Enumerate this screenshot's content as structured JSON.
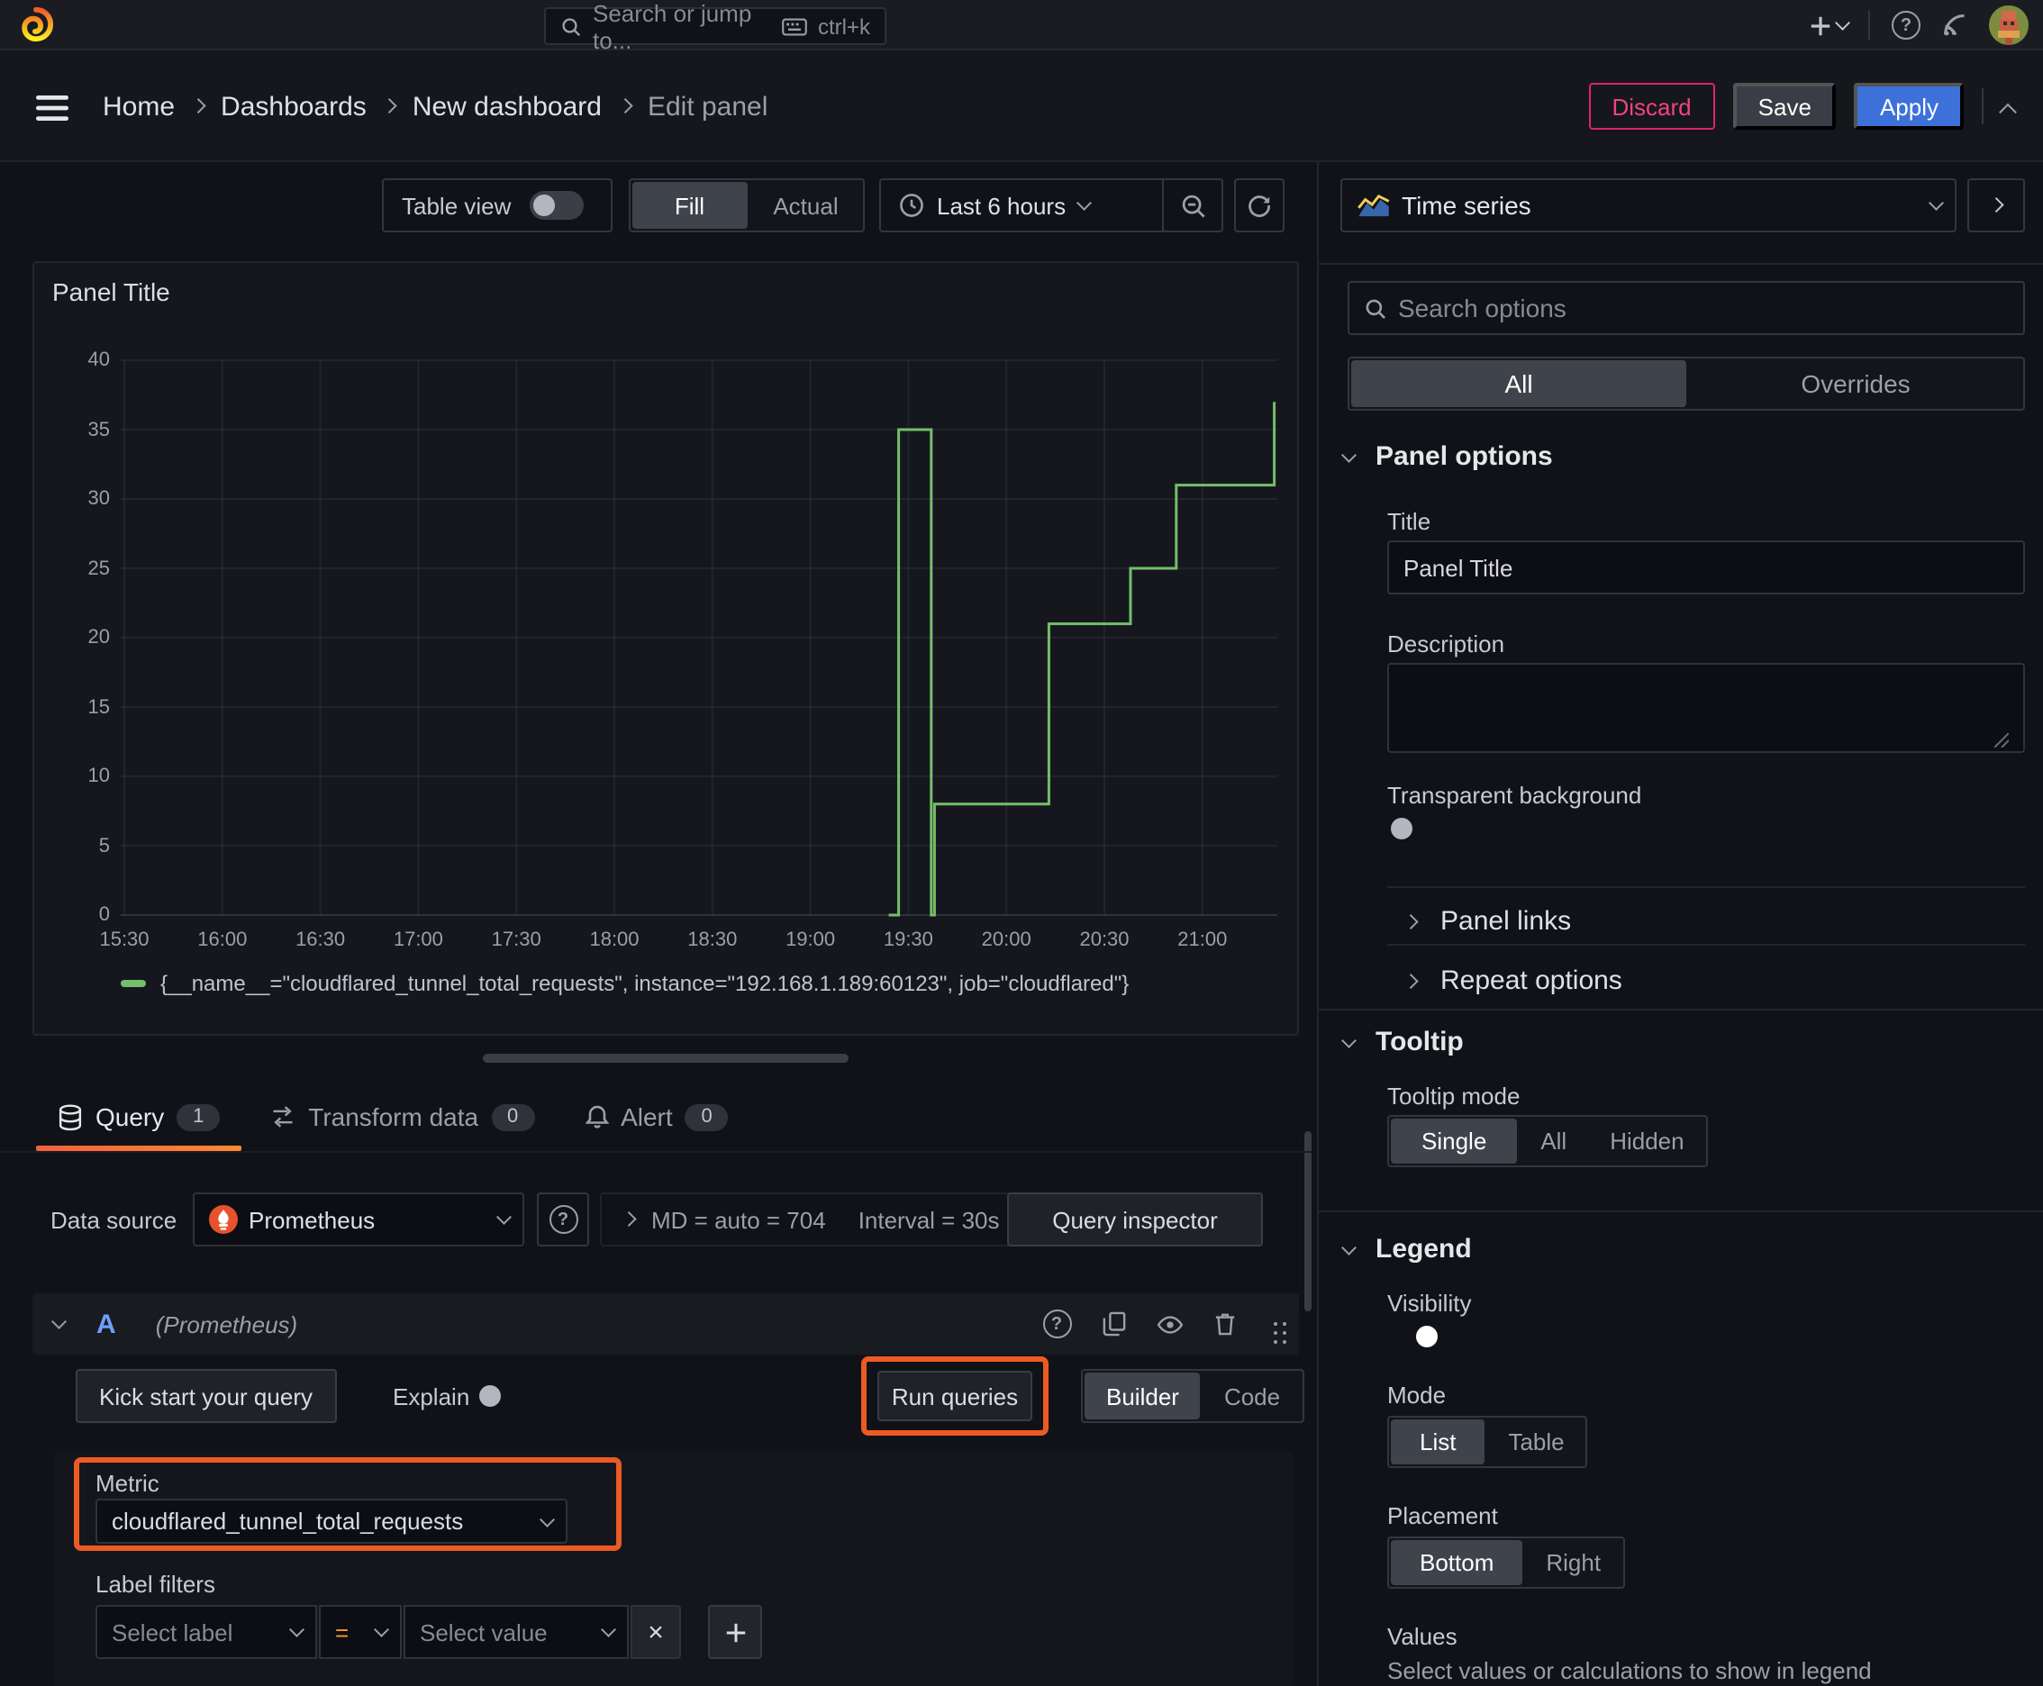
{
  "colors": {
    "green": "#73BF69",
    "annotation": "#ec5b24",
    "blue": "#3D71D9",
    "tab_gradient_start": "#F55F3E",
    "tab_gradient_end": "#FF8833"
  },
  "icons": {
    "help": "?",
    "close": "×"
  },
  "topbar": {
    "search_placeholder": "Search or jump to...",
    "shortcut": "ctrl+k"
  },
  "nav": {
    "breadcrumbs": [
      "Home",
      "Dashboards",
      "New dashboard",
      "Edit panel"
    ],
    "discard": "Discard",
    "save": "Save",
    "apply": "Apply"
  },
  "toolbar": {
    "table_view": "Table view",
    "fill": "Fill",
    "actual": "Actual",
    "time_range": "Last 6 hours"
  },
  "panel": {
    "title": "Panel Title"
  },
  "chart_data": {
    "type": "line",
    "title": "Panel Title",
    "line_interpolation": "step-after",
    "grid": true,
    "legend_position": "bottom",
    "ylim": [
      0,
      40
    ],
    "y_ticks": [
      0,
      5,
      10,
      15,
      20,
      25,
      30,
      35,
      40
    ],
    "x_ticks": [
      "15:30",
      "16:00",
      "16:30",
      "17:00",
      "17:30",
      "18:00",
      "18:30",
      "19:00",
      "19:30",
      "20:00",
      "20:30",
      "21:00"
    ],
    "series": [
      {
        "name": "{__name__=\"cloudflared_tunnel_total_requests\", instance=\"192.168.1.189:60123\", job=\"cloudflared\"}",
        "color": "#73BF69",
        "points": [
          [
            "19:24",
            0
          ],
          [
            "19:27",
            0
          ],
          [
            "19:27",
            35
          ],
          [
            "19:37",
            35
          ],
          [
            "19:37",
            0
          ],
          [
            "19:38",
            0
          ],
          [
            "19:38",
            8
          ],
          [
            "20:13",
            8
          ],
          [
            "20:13",
            21
          ],
          [
            "20:38",
            21
          ],
          [
            "20:38",
            25
          ],
          [
            "20:52",
            25
          ],
          [
            "20:52",
            31
          ],
          [
            "21:22",
            31
          ],
          [
            "21:22",
            37
          ]
        ]
      }
    ]
  },
  "tabs": [
    {
      "label": "Query",
      "count": "1"
    },
    {
      "label": "Transform data",
      "count": "0"
    },
    {
      "label": "Alert",
      "count": "0"
    }
  ],
  "query_toolbar": {
    "ds_label": "Data source",
    "ds_value": "Prometheus",
    "stats_md": "MD = auto = 704",
    "stats_interval": "Interval = 30s",
    "inspector": "Query inspector"
  },
  "query_row": {
    "ref": "A",
    "ds_hint": "(Prometheus)"
  },
  "query_actions": {
    "kickstart": "Kick start your query",
    "explain": "Explain",
    "run": "Run queries",
    "builder": "Builder",
    "code": "Code"
  },
  "metric": {
    "label": "Metric",
    "value": "cloudflared_tunnel_total_requests"
  },
  "filters": {
    "label": "Label filters",
    "select_label": "Select label",
    "operator": "=",
    "select_value": "Select value"
  },
  "options": {
    "viz": "Time series",
    "search_placeholder": "Search options",
    "tabs": [
      "All",
      "Overrides"
    ],
    "panel_options": {
      "header": "Panel options",
      "title_label": "Title",
      "title_value": "Panel Title",
      "description_label": "Description",
      "transparent_label": "Transparent background"
    },
    "panel_links": "Panel links",
    "repeat_options": "Repeat options",
    "tooltip": {
      "header": "Tooltip",
      "mode_label": "Tooltip mode",
      "modes": [
        "Single",
        "All",
        "Hidden"
      ],
      "selected": "Single"
    },
    "legend": {
      "header": "Legend",
      "visibility_label": "Visibility",
      "mode_label": "Mode",
      "modes": [
        "List",
        "Table"
      ],
      "selected_mode": "List",
      "placement_label": "Placement",
      "placements": [
        "Bottom",
        "Right"
      ],
      "selected_placement": "Bottom",
      "values_label": "Values",
      "values_hint": "Select values or calculations to show in legend"
    }
  }
}
